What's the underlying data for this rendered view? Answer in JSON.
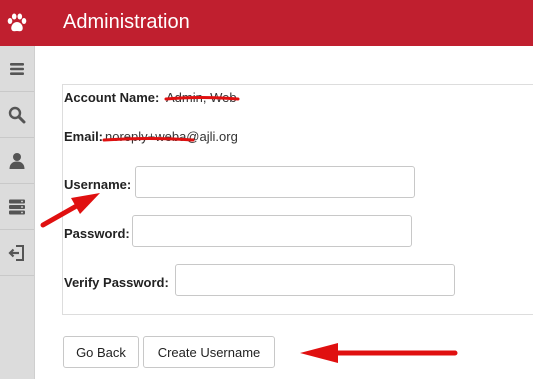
{
  "header": {
    "title": "Administration",
    "logo_icon": "paw-icon",
    "brand_color": "#c01f2f"
  },
  "sidebar": {
    "items": [
      {
        "icon": "menu-icon"
      },
      {
        "icon": "search-icon"
      },
      {
        "icon": "user-icon"
      },
      {
        "icon": "database-icon"
      },
      {
        "icon": "sign-out-icon"
      }
    ]
  },
  "form": {
    "account_name_label": "Account Name:",
    "account_name_value": "Admin, Web",
    "email_label": "Email:",
    "email_value": "noreply+weba@ajli.org",
    "username_label": "Username:",
    "username_value": "",
    "password_label": "Password:",
    "password_value": "",
    "verify_password_label": "Verify Password:",
    "verify_password_value": ""
  },
  "buttons": {
    "back_label": "Go Back",
    "create_label": "Create Username"
  },
  "annotation_color": "#e01010"
}
